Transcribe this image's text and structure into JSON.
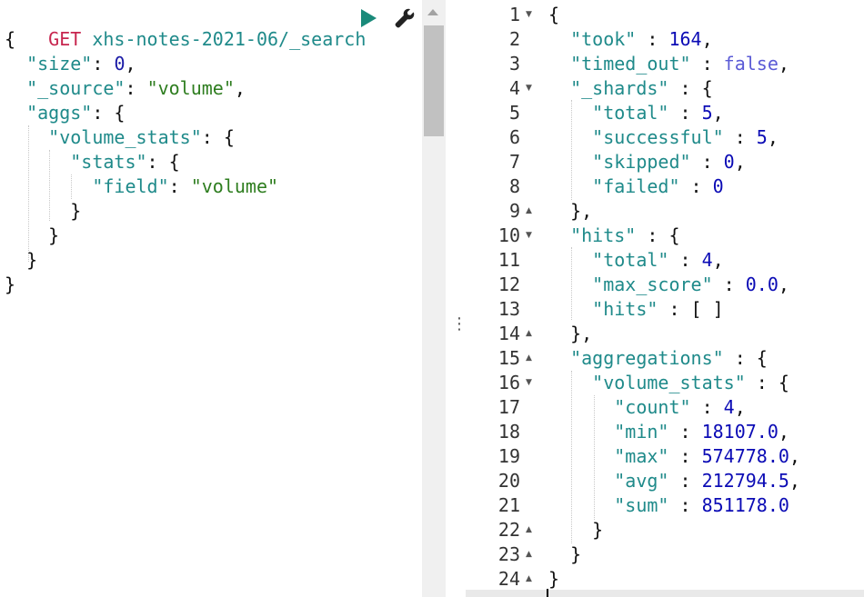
{
  "request": {
    "method": "GET",
    "url": "xhs-notes-2021-06/_search",
    "lines": [
      [
        [
          "{",
          "k-punc"
        ]
      ],
      [
        [
          "  ",
          ""
        ],
        [
          "\"size\"",
          "k-key"
        ],
        [
          ": ",
          "k-punc"
        ],
        [
          "0",
          "k-num"
        ],
        [
          ",",
          "k-punc"
        ]
      ],
      [
        [
          "  ",
          ""
        ],
        [
          "\"_source\"",
          "k-key"
        ],
        [
          ": ",
          "k-punc"
        ],
        [
          "\"volume\"",
          "k-str"
        ],
        [
          ",",
          "k-punc"
        ]
      ],
      [
        [
          "  ",
          ""
        ],
        [
          "\"aggs\"",
          "k-key"
        ],
        [
          ": {",
          "k-punc"
        ]
      ],
      [
        [
          "    ",
          ""
        ],
        [
          "\"volume_stats\"",
          "k-key"
        ],
        [
          ": {",
          "k-punc"
        ]
      ],
      [
        [
          "      ",
          ""
        ],
        [
          "\"stats\"",
          "k-key"
        ],
        [
          ": {",
          "k-punc"
        ]
      ],
      [
        [
          "        ",
          ""
        ],
        [
          "\"field\"",
          "k-key"
        ],
        [
          ": ",
          "k-punc"
        ],
        [
          "\"volume\"",
          "k-str"
        ]
      ],
      [
        [
          "      ",
          ""
        ],
        [
          "}",
          "k-punc"
        ]
      ],
      [
        [
          "    ",
          ""
        ],
        [
          "}",
          "k-punc"
        ]
      ],
      [
        [
          "  ",
          ""
        ],
        [
          "}",
          "k-punc"
        ]
      ],
      [
        [
          "}",
          "k-punc"
        ]
      ]
    ]
  },
  "toolbar": {
    "run_icon": "play-icon",
    "settings_icon": "wrench-icon"
  },
  "response": {
    "line_numbers": [
      "1",
      "2",
      "3",
      "4",
      "5",
      "6",
      "7",
      "8",
      "9",
      "10",
      "11",
      "12",
      "13",
      "14",
      "15",
      "16",
      "17",
      "18",
      "19",
      "20",
      "21",
      "22",
      "23",
      "24"
    ],
    "folds": {
      "1": "down",
      "4": "down",
      "9": "up",
      "10": "down",
      "14": "up",
      "15": "up",
      "16": "down",
      "22": "up",
      "23": "up",
      "24": "up"
    },
    "lines": [
      [
        [
          "{",
          "k-punc"
        ]
      ],
      [
        [
          "  ",
          ""
        ],
        [
          "\"took\"",
          "r-key"
        ],
        [
          " : ",
          "k-punc"
        ],
        [
          "164",
          "r-num"
        ],
        [
          ",",
          "k-punc"
        ]
      ],
      [
        [
          "  ",
          ""
        ],
        [
          "\"timed_out\"",
          "r-key"
        ],
        [
          " : ",
          "k-punc"
        ],
        [
          "false",
          "r-bool"
        ],
        [
          ",",
          "k-punc"
        ]
      ],
      [
        [
          "  ",
          ""
        ],
        [
          "\"_shards\"",
          "r-key"
        ],
        [
          " : {",
          "k-punc"
        ]
      ],
      [
        [
          "    ",
          ""
        ],
        [
          "\"total\"",
          "r-key"
        ],
        [
          " : ",
          "k-punc"
        ],
        [
          "5",
          "r-num"
        ],
        [
          ",",
          "k-punc"
        ]
      ],
      [
        [
          "    ",
          ""
        ],
        [
          "\"successful\"",
          "r-key"
        ],
        [
          " : ",
          "k-punc"
        ],
        [
          "5",
          "r-num"
        ],
        [
          ",",
          "k-punc"
        ]
      ],
      [
        [
          "    ",
          ""
        ],
        [
          "\"skipped\"",
          "r-key"
        ],
        [
          " : ",
          "k-punc"
        ],
        [
          "0",
          "r-num"
        ],
        [
          ",",
          "k-punc"
        ]
      ],
      [
        [
          "    ",
          ""
        ],
        [
          "\"failed\"",
          "r-key"
        ],
        [
          " : ",
          "k-punc"
        ],
        [
          "0",
          "r-num"
        ]
      ],
      [
        [
          "  ",
          ""
        ],
        [
          "},",
          "k-punc"
        ]
      ],
      [
        [
          "  ",
          ""
        ],
        [
          "\"hits\"",
          "r-key"
        ],
        [
          " : {",
          "k-punc"
        ]
      ],
      [
        [
          "    ",
          ""
        ],
        [
          "\"total\"",
          "r-key"
        ],
        [
          " : ",
          "k-punc"
        ],
        [
          "4",
          "r-num"
        ],
        [
          ",",
          "k-punc"
        ]
      ],
      [
        [
          "    ",
          ""
        ],
        [
          "\"max_score\"",
          "r-key"
        ],
        [
          " : ",
          "k-punc"
        ],
        [
          "0.0",
          "r-num"
        ],
        [
          ",",
          "k-punc"
        ]
      ],
      [
        [
          "    ",
          ""
        ],
        [
          "\"hits\"",
          "r-key"
        ],
        [
          " : [ ]",
          "k-punc"
        ]
      ],
      [
        [
          "  ",
          ""
        ],
        [
          "},",
          "k-punc"
        ]
      ],
      [
        [
          "  ",
          ""
        ],
        [
          "\"aggregations\"",
          "r-key"
        ],
        [
          " : {",
          "k-punc"
        ]
      ],
      [
        [
          "    ",
          ""
        ],
        [
          "\"volume_stats\"",
          "r-key"
        ],
        [
          " : {",
          "k-punc"
        ]
      ],
      [
        [
          "      ",
          ""
        ],
        [
          "\"count\"",
          "r-key"
        ],
        [
          " : ",
          "k-punc"
        ],
        [
          "4",
          "r-num"
        ],
        [
          ",",
          "k-punc"
        ]
      ],
      [
        [
          "      ",
          ""
        ],
        [
          "\"min\"",
          "r-key"
        ],
        [
          " : ",
          "k-punc"
        ],
        [
          "18107.0",
          "r-num"
        ],
        [
          ",",
          "k-punc"
        ]
      ],
      [
        [
          "      ",
          ""
        ],
        [
          "\"max\"",
          "r-key"
        ],
        [
          " : ",
          "k-punc"
        ],
        [
          "574778.0",
          "r-num"
        ],
        [
          ",",
          "k-punc"
        ]
      ],
      [
        [
          "      ",
          ""
        ],
        [
          "\"avg\"",
          "r-key"
        ],
        [
          " : ",
          "k-punc"
        ],
        [
          "212794.5",
          "r-num"
        ],
        [
          ",",
          "k-punc"
        ]
      ],
      [
        [
          "      ",
          ""
        ],
        [
          "\"sum\"",
          "r-key"
        ],
        [
          " : ",
          "k-punc"
        ],
        [
          "851178.0",
          "r-num"
        ]
      ],
      [
        [
          "    ",
          ""
        ],
        [
          "}",
          "k-punc"
        ]
      ],
      [
        [
          "  ",
          ""
        ],
        [
          "}",
          "k-punc"
        ]
      ],
      [
        [
          "}",
          "k-punc"
        ]
      ]
    ]
  },
  "resize_handle": "⋮"
}
